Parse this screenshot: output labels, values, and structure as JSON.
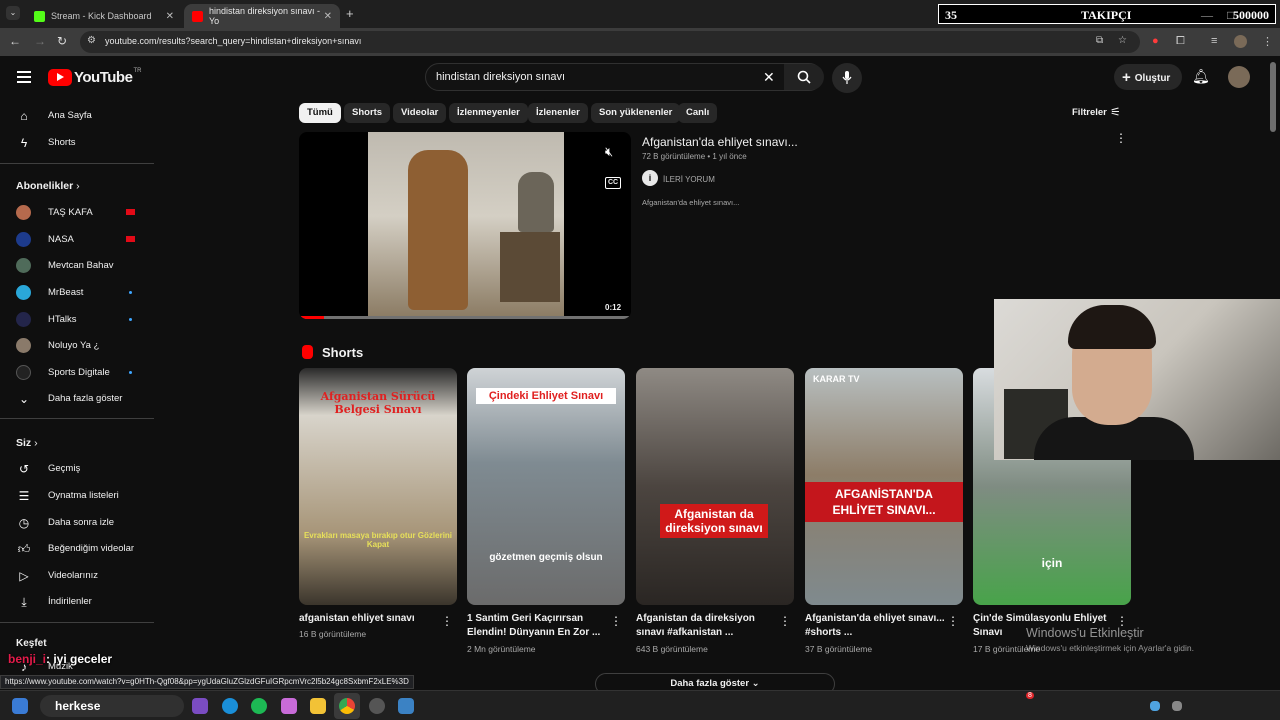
{
  "browser": {
    "tabs": [
      {
        "title": "Stream - Kick Dashboard",
        "favicon_color": "#53fc18"
      },
      {
        "title": "hindistan direksiyon sınavı - Yo",
        "favicon_color": "#ff0000"
      }
    ],
    "new_tab": "+",
    "url": "youtube.com/results?search_query=hindistan+direksiyon+sınavı"
  },
  "stream_overlay": {
    "count": "35",
    "label": "TAKIPÇI",
    "goal": "500000",
    "min": "—",
    "max": "□"
  },
  "youtube": {
    "logo_word": "YouTube",
    "logo_region": "TR",
    "search": {
      "query": "hindistan direksiyon sınavı"
    },
    "create_label": "Oluştur"
  },
  "sidebar": {
    "main": [
      {
        "label": "Ana Sayfa",
        "icon": "home-icon"
      },
      {
        "label": "Shorts",
        "icon": "shorts-icon"
      }
    ],
    "subscriptions_heading": "Abonelikler",
    "subscriptions": [
      {
        "label": "TAŞ KAFA",
        "color": "#b56a4d"
      },
      {
        "label": "NASA",
        "color": "#1d3b8c"
      },
      {
        "label": "Mevtcan Bahav",
        "color": "#4f6b5a"
      },
      {
        "label": "MrBeast",
        "color": "#2aa7d9"
      },
      {
        "label": "HTalks",
        "color": "#23254a"
      },
      {
        "label": "Noluyo Ya ¿",
        "color": "#8a7a6a"
      },
      {
        "label": "Sports Digitale",
        "color": "#222222"
      }
    ],
    "show_more": "Daha fazla göster",
    "you_heading": "Siz",
    "you": [
      {
        "label": "Geçmiş",
        "icon": "history-icon"
      },
      {
        "label": "Oynatma listeleri",
        "icon": "playlist-icon"
      },
      {
        "label": "Daha sonra izle",
        "icon": "watch-later-icon"
      },
      {
        "label": "Beğendiğim videolar",
        "icon": "like-icon"
      },
      {
        "label": "Videolarınız",
        "icon": "your-videos-icon"
      },
      {
        "label": "İndirilenler",
        "icon": "download-icon"
      }
    ],
    "explore_heading": "Keşfet",
    "explore_music": "Müzik"
  },
  "chips": [
    "Tümü",
    "Shorts",
    "Videolar",
    "İzlenmeyenler",
    "İzlenenler",
    "Son yüklenenler",
    "Canlı"
  ],
  "filters_label": "Filtreler",
  "featured": {
    "title": "Afganistan'da ehliyet sınavı...",
    "meta": "72 B görüntüleme • 1 yıl önce",
    "channel": "İLERİ YORUM",
    "channel_initial": "i",
    "description": "Afganistan'da ehliyet sınavı...",
    "duration": "0:12",
    "progress": 0.07
  },
  "shorts_heading": "Shorts",
  "shorts": [
    {
      "title": "afganistan ehliyet sınavı",
      "views": "16 B görüntüleme",
      "top_caption": "Afganistan Sürücü Belgesi Sınavı",
      "bottom_caption": "Evrakları masaya bırakıp otur Gözlerini Kapat"
    },
    {
      "title": "1 Santim Geri Kaçırırsan Elendin! Dünyanın En Zor ...",
      "views": "2 Mn görüntüleme",
      "top_caption": "Çindeki Ehliyet Sınavı",
      "bottom_caption": "gözetmen geçmiş olsun"
    },
    {
      "title": "Afganistan da direksiyon sınavı #afkanistan ...",
      "views": "643 B görüntüleme",
      "top_caption": "",
      "bottom_caption": "Afganistan da direksiyon sınavı"
    },
    {
      "title": "Afganistan'da ehliyet sınavı... #shorts ...",
      "views": "37 B görüntüleme",
      "top_caption": "KARAR TV",
      "bottom_caption": "AFGANİSTAN'DA EHLİYET SINAVI..."
    },
    {
      "title": "Çin'de Simülasyonlu Ehliyet Sınavı",
      "views": "17 B görüntüleme",
      "top_caption": "",
      "bottom_caption": "için"
    }
  ],
  "show_more_button": "Daha fazla göster",
  "status_url": "https://www.youtube.com/watch?v=g0HTh-Qgf08&pp=ygUdaGluZGlzdGFuIGRpcmVrc2l5b24gc8SxbmF2xLE%3D",
  "chat": {
    "user": "benji_i",
    "message": ": iyi geceler"
  },
  "windows_activation": {
    "title": "Windows'u Etkinleştir",
    "subtitle": "Windows'u etkinleştirmek için Ayarlar'a gidin."
  },
  "taskbar": {
    "search_text": "herkese",
    "badge": "8"
  }
}
